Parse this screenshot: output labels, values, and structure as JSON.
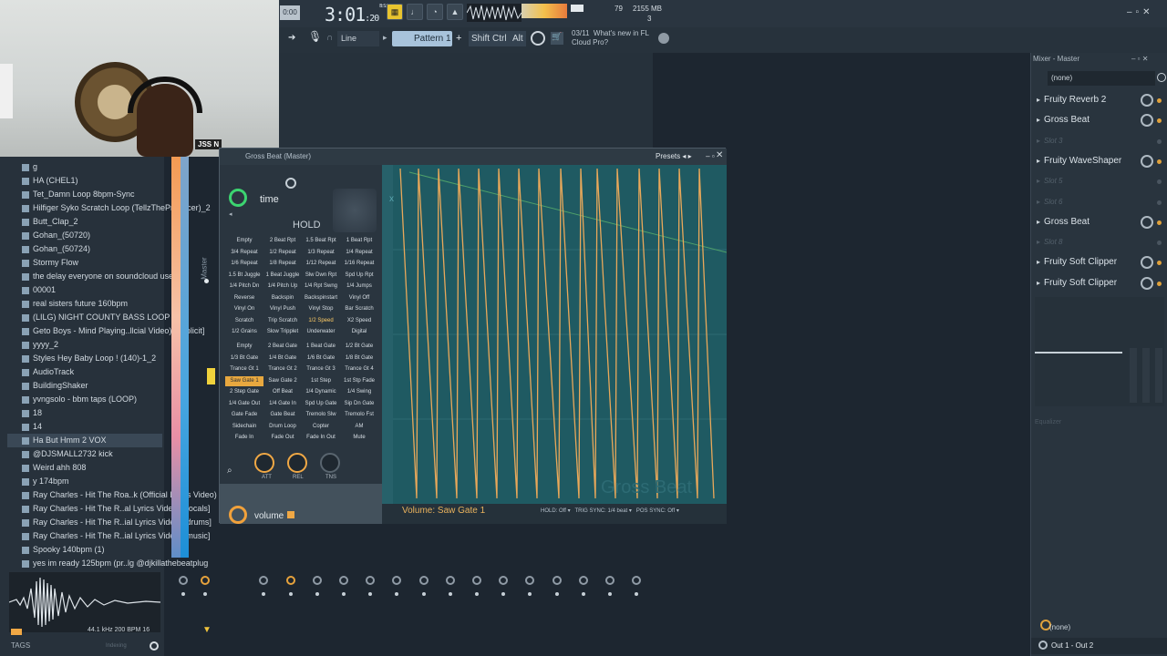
{
  "webcam": {
    "overlay_label": "JSS N"
  },
  "topbar": {
    "song_position_display": "0:00",
    "time_main": "3:01",
    "time_sub": "20",
    "time_unit": "B:S:T",
    "cpu_value": "79",
    "ram_value": "2155 MB",
    "voices": "3",
    "snap_mode": "Line",
    "pattern": "Pattern 1",
    "modifiers": [
      "Shift",
      "Ctrl",
      "Alt"
    ],
    "news_date": "03/11",
    "news_text": "What's new in FL Cloud Pro?"
  },
  "browser": {
    "items": [
      {
        "label": "g"
      },
      {
        "label": "HA (CHEL1)"
      },
      {
        "label": "Tet_Damn Loop 8bpm-Sync"
      },
      {
        "label": "Hilfiger Syko Scratch Loop (TellzTheProducer)_2"
      },
      {
        "label": "Butt_Clap_2"
      },
      {
        "label": "Gohan_(50720)"
      },
      {
        "label": "Gohan_(50724)"
      },
      {
        "label": "Stormy Flow"
      },
      {
        "label": "the delay everyone on soundcloud uses"
      },
      {
        "label": "00001"
      },
      {
        "label": "real sisters future 160bpm"
      },
      {
        "label": "(LILG) NIGHT COUNTY BASS LOOP"
      },
      {
        "label": "Geto Boys - Mind Playing..llcial Video) [Explicit]"
      },
      {
        "label": "yyyy_2"
      },
      {
        "label": "Styles Hey Baby Loop ! (140)-1_2"
      },
      {
        "label": "AudioTrack"
      },
      {
        "label": "BuildingShaker"
      },
      {
        "label": "yvngsolo - bbm taps (LOOP)"
      },
      {
        "label": "18"
      },
      {
        "label": "14"
      },
      {
        "label": "Ha But Hmm 2 VOX"
      },
      {
        "label": "@DJSMALL2732 kick"
      },
      {
        "label": "Weird ahh 808"
      },
      {
        "label": "y 174bpm"
      },
      {
        "label": "Ray Charles - Hit The Roa..k (Official Lyrics Video)"
      },
      {
        "label": "Ray Charles - Hit The R..al Lyrics Video) [vocals]"
      },
      {
        "label": "Ray Charles - Hit The R..ial Lyrics Video) [drums]"
      },
      {
        "label": "Ray Charles - Hit The R..ial Lyrics Video) [music]"
      },
      {
        "label": "Spooky 140bpm (1)"
      },
      {
        "label": "yes im ready 125bpm (pr..lg @djkillathebeatplug"
      }
    ],
    "selected_index": 20,
    "sample_info": "44.1 kHz 200 BPM 16",
    "tags_label": "TAGS",
    "indexing_label": "Indexing"
  },
  "channel_strip": {
    "label": "Master"
  },
  "plugin": {
    "title": "Gross Beat (Master)",
    "presets_label": "Presets",
    "time_label": "time",
    "hold_label": "HOLD",
    "time_presets": [
      "Empty",
      "2 Beat Rpt",
      "1.5 Beat Rpt",
      "1 Beat Rpt",
      "3/4 Repeat",
      "1/2 Repeat",
      "1/3 Repeat",
      "1/4 Repeat",
      "1/6 Repeat",
      "1/8 Repeat",
      "1/12 Repeat",
      "1/16 Repeat",
      "1.5 Bt Juggle",
      "1 Beat Juggle",
      "Slw Dwn Rpt",
      "Spd Up Rpt",
      "1/4 Pitch Dn",
      "1/4 Pitch Up",
      "1/4 Rpt Swng",
      "1/4 Jumps",
      "Reverse",
      "Backspin",
      "Backspinstart",
      "Vinyl Off",
      "Vinyl On",
      "Vinyl Push",
      "Vinyl Stop",
      "Bar Scratch",
      "Scratch",
      "Trip Scratch",
      "1/2 Speed",
      "X2 Speed",
      "1/2 Grains",
      "Slow Tripplet",
      "Underwater",
      "Digital"
    ],
    "time_selected": "1/2 Speed",
    "volume_presets": [
      "Empty",
      "2 Beat Gate",
      "1 Beat Gate",
      "1/2 Bt Gate",
      "1/3 Bt Gate",
      "1/4 Bt Gate",
      "1/6 Bt Gate",
      "1/8 Bt Gate",
      "Trance Gt 1",
      "Trance Gt 2",
      "Trance Gt 3",
      "Trance Gt 4",
      "Saw Gate 1",
      "Saw Gate 2",
      "1st Step",
      "1st Stp Fade",
      "2 Step Gate",
      "Off Beat",
      "1/4 Dynamic",
      "1/4 Swing",
      "1/4 Gate Out",
      "1/4 Gate In",
      "Spd Up Gate",
      "Sip Dn Gate",
      "Gate Fade",
      "Gate Beat",
      "Tremolo Slw",
      "Tremolo Fst",
      "Sidechain",
      "Drum Loop",
      "Copter",
      "AM",
      "Fade In",
      "Fade Out",
      "Fade In Out",
      "Mute"
    ],
    "volume_selected": "Saw Gate 1",
    "knobs": [
      {
        "label": "ATT"
      },
      {
        "label": "REL"
      },
      {
        "label": "TNS"
      }
    ],
    "volume_label": "volume",
    "graph_title": "Volume: Saw Gate 1",
    "hold_opt": "HOLD:",
    "hold_val": "Off",
    "trig_opt": "TRIG SYNC:",
    "trig_val": "1/4 beat",
    "pos_opt": "POS SYNC:",
    "pos_val": "Off",
    "watermark": "Gross Beat",
    "colors": {
      "accent": "#f0a845",
      "graph_bg": "#1f5a62",
      "time_knob": "#3cd470"
    }
  },
  "mixer": {
    "title": "Mixer - Master",
    "input": "(none)",
    "slots": [
      {
        "label": "Fruity Reverb 2",
        "active": true
      },
      {
        "label": "Gross Beat",
        "active": true
      },
      {
        "label": "Slot 3",
        "active": false
      },
      {
        "label": "Fruity WaveShaper",
        "active": true
      },
      {
        "label": "Slot 5",
        "active": false
      },
      {
        "label": "Slot 6",
        "active": false
      },
      {
        "label": "Gross Beat",
        "active": true
      },
      {
        "label": "Slot 8",
        "active": false
      },
      {
        "label": "Fruity Soft Clipper",
        "active": true
      },
      {
        "label": "Fruity Soft Clipper",
        "active": true
      }
    ],
    "eq_label": "Equalizer",
    "bottom_input": "(none)",
    "output": "Out 1 - Out 2"
  }
}
